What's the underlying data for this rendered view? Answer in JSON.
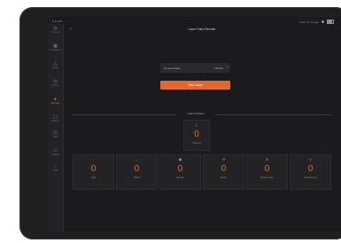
{
  "status_bar": {
    "time": "9:41 AM",
    "right_text": "Laser Unmerged"
  },
  "nav": {
    "title": "Laser Pairs Remote"
  },
  "sidebar": {
    "items": [
      {
        "label": "Connect",
        "icon": "connect-icon",
        "glyph": "◎"
      },
      {
        "label": "Dashboard",
        "icon": "dashboard-icon",
        "glyph": "▦"
      },
      {
        "label": "Alerts",
        "icon": "alert-icon",
        "glyph": "△"
      },
      {
        "label": "History",
        "icon": "history-icon",
        "glyph": "◷"
      },
      {
        "label": "Remote",
        "icon": "remote-icon",
        "glyph": "●"
      },
      {
        "label": "Devices",
        "icon": "devices-icon",
        "glyph": "▢"
      },
      {
        "label": "Tests",
        "icon": "tests-icon",
        "glyph": "◳"
      },
      {
        "label": "Settings",
        "icon": "settings-icon",
        "glyph": "▭"
      },
      {
        "label": "Help",
        "icon": "help-icon",
        "glyph": "◌"
      }
    ],
    "active_index": 4
  },
  "connect": {
    "label": "Connect Alias",
    "value": "ABCDE"
  },
  "start_button": {
    "label": "Start Listen"
  },
  "latest": {
    "label": "Latest Version"
  },
  "main_card": {
    "icon": "box-icon",
    "glyph": "▯",
    "value": "0",
    "label": "Unknown"
  },
  "counts": [
    {
      "icon": "light-icon",
      "glyph": "◦",
      "value": "0",
      "label": "Light"
    },
    {
      "icon": "motion-icon",
      "glyph": "—",
      "value": "0",
      "label": "Motion"
    },
    {
      "icon": "sensor-icon",
      "glyph": "▣",
      "value": "0",
      "label": "Sensor"
    },
    {
      "icon": "meter-icon",
      "glyph": "⊖",
      "value": "0",
      "label": "Meter"
    },
    {
      "icon": "power-icon",
      "glyph": "◘",
      "value": "0",
      "label": "Power Outlet"
    },
    {
      "icon": "smart-icon",
      "glyph": "◇",
      "value": "0",
      "label": "Smart Sensor"
    }
  ],
  "colors": {
    "accent": "#e2692d",
    "background": "#1b1b1d",
    "card": "#232325"
  }
}
